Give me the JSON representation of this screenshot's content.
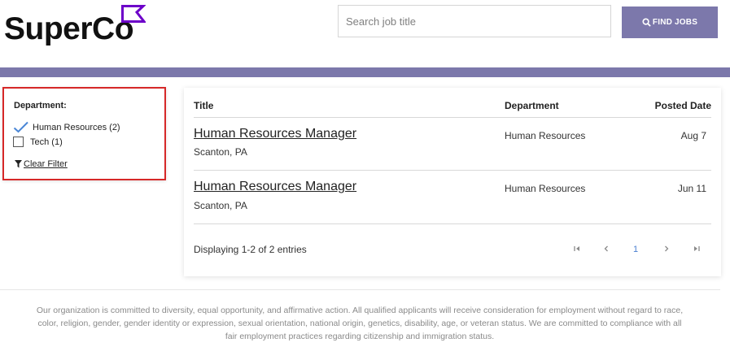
{
  "header": {
    "logo_text": "SuperCo",
    "brand_color": "#6d00c9",
    "accent_color": "#7c78ab",
    "search_placeholder": "Search job title",
    "search_value": "",
    "find_button_label": "FIND JOBS",
    "find_button_icon": "search-icon"
  },
  "filter": {
    "heading": "Department:",
    "options": [
      {
        "label": "Human Resources (2)",
        "checked": true
      },
      {
        "label": "Tech (1)",
        "checked": false
      }
    ],
    "clear_label": "Clear Filter",
    "clear_icon": "funnel-icon"
  },
  "jobs_table": {
    "columns": [
      "Title",
      "Department",
      "Posted Date"
    ],
    "rows": [
      {
        "title": "Human Resources Manager",
        "location": "Scanton, PA",
        "department": "Human Resources",
        "posted": "Aug 7"
      },
      {
        "title": "Human Resources Manager",
        "location": "Scanton, PA",
        "department": "Human Resources",
        "posted": "Jun 11"
      }
    ],
    "summary": "Displaying 1-2 of 2 entries"
  },
  "pagination": {
    "first_icon": "first-page-icon",
    "prev_icon": "prev-page-icon",
    "current_page": "1",
    "next_icon": "next-page-icon",
    "last_icon": "last-page-icon"
  },
  "footer": {
    "text": "Our organization is committed to diversity, equal opportunity, and affirmative action. All qualified applicants will receive consideration for employment without regard to race, color, religion, gender, gender identity or expression, sexual orientation, national origin, genetics, disability, age, or veteran status. We are committed to compliance with all fair employment practices regarding citizenship and immigration status."
  }
}
